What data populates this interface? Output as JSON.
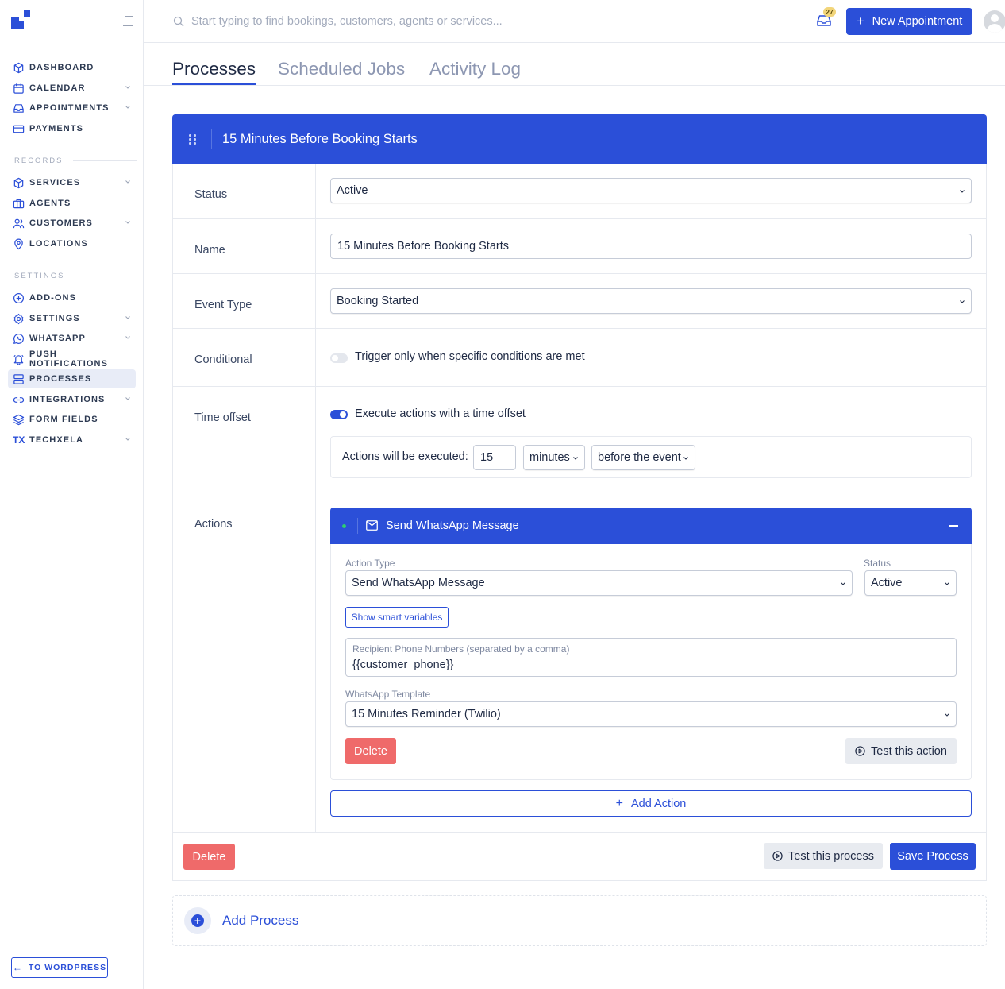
{
  "sidebar": {
    "items_main": [
      {
        "label": "DASHBOARD",
        "icon": "box-icon",
        "chevron": false
      },
      {
        "label": "CALENDAR",
        "icon": "calendar-icon",
        "chevron": true
      },
      {
        "label": "APPOINTMENTS",
        "icon": "inbox-icon",
        "chevron": true
      },
      {
        "label": "PAYMENTS",
        "icon": "credit-card-icon",
        "chevron": false
      }
    ],
    "records_label": "RECORDS",
    "items_records": [
      {
        "label": "SERVICES",
        "icon": "box-icon",
        "chevron": true
      },
      {
        "label": "AGENTS",
        "icon": "briefcase-icon",
        "chevron": false
      },
      {
        "label": "CUSTOMERS",
        "icon": "users-icon",
        "chevron": true
      },
      {
        "label": "LOCATIONS",
        "icon": "map-pin-icon",
        "chevron": false
      }
    ],
    "settings_label": "SETTINGS",
    "items_settings": [
      {
        "label": "ADD-ONS",
        "icon": "plus-circle-icon",
        "chevron": false
      },
      {
        "label": "SETTINGS",
        "icon": "gear-icon",
        "chevron": true
      },
      {
        "label": "WHATSAPP",
        "icon": "whatsapp-icon",
        "chevron": true
      },
      {
        "label": "PUSH NOTIFICATIONS",
        "icon": "bell-icon",
        "chevron": false
      },
      {
        "label": "PROCESSES",
        "icon": "server-icon",
        "chevron": false,
        "active": true
      },
      {
        "label": "INTEGRATIONS",
        "icon": "link-icon",
        "chevron": true
      },
      {
        "label": "FORM FIELDS",
        "icon": "layers-icon",
        "chevron": false
      },
      {
        "label": "TECHXELA",
        "icon": "tx-icon",
        "icon_text": "TX",
        "chevron": true
      }
    ],
    "to_wordpress": "TO WORDPRESS"
  },
  "topbar": {
    "search_placeholder": "Start typing to find bookings, customers, agents or services...",
    "notification_count": "27",
    "new_appointment_label": "New Appointment"
  },
  "tabs": [
    "Processes",
    "Scheduled Jobs",
    "Activity Log"
  ],
  "process": {
    "title": "15 Minutes Before Booking Starts",
    "status_label": "Status",
    "status_value": "Active",
    "name_label": "Name",
    "name_value": "15 Minutes Before Booking Starts",
    "event_type_label": "Event Type",
    "event_type_value": "Booking Started",
    "conditional_label": "Conditional",
    "conditional_text": "Trigger only when specific conditions are met",
    "conditional_on": false,
    "time_offset_label": "Time offset",
    "time_offset_text": "Execute actions with a time offset",
    "time_offset_on": true,
    "offset_prefix": "Actions will be executed:",
    "offset_value": "15",
    "offset_unit": "minutes",
    "offset_direction": "before the event",
    "actions_label": "Actions",
    "action": {
      "title": "Send WhatsApp Message",
      "action_type_label": "Action Type",
      "action_type_value": "Send WhatsApp Message",
      "status_label": "Status",
      "status_value": "Active",
      "smart_variables_label": "Show smart variables",
      "recipient_label": "Recipient Phone Numbers (separated by a comma)",
      "recipient_value": "{{customer_phone}}",
      "template_label": "WhatsApp Template",
      "template_value": "15 Minutes Reminder (Twilio)",
      "delete_label": "Delete",
      "test_label": "Test this action"
    },
    "add_action_label": "Add Action",
    "delete_label": "Delete",
    "test_process_label": "Test this process",
    "save_label": "Save Process"
  },
  "add_process_label": "Add Process",
  "colors": {
    "accent": "#2b4fd8",
    "danger": "#ef6a6a",
    "success": "#2ecc71",
    "badge": "#f2d57a"
  }
}
